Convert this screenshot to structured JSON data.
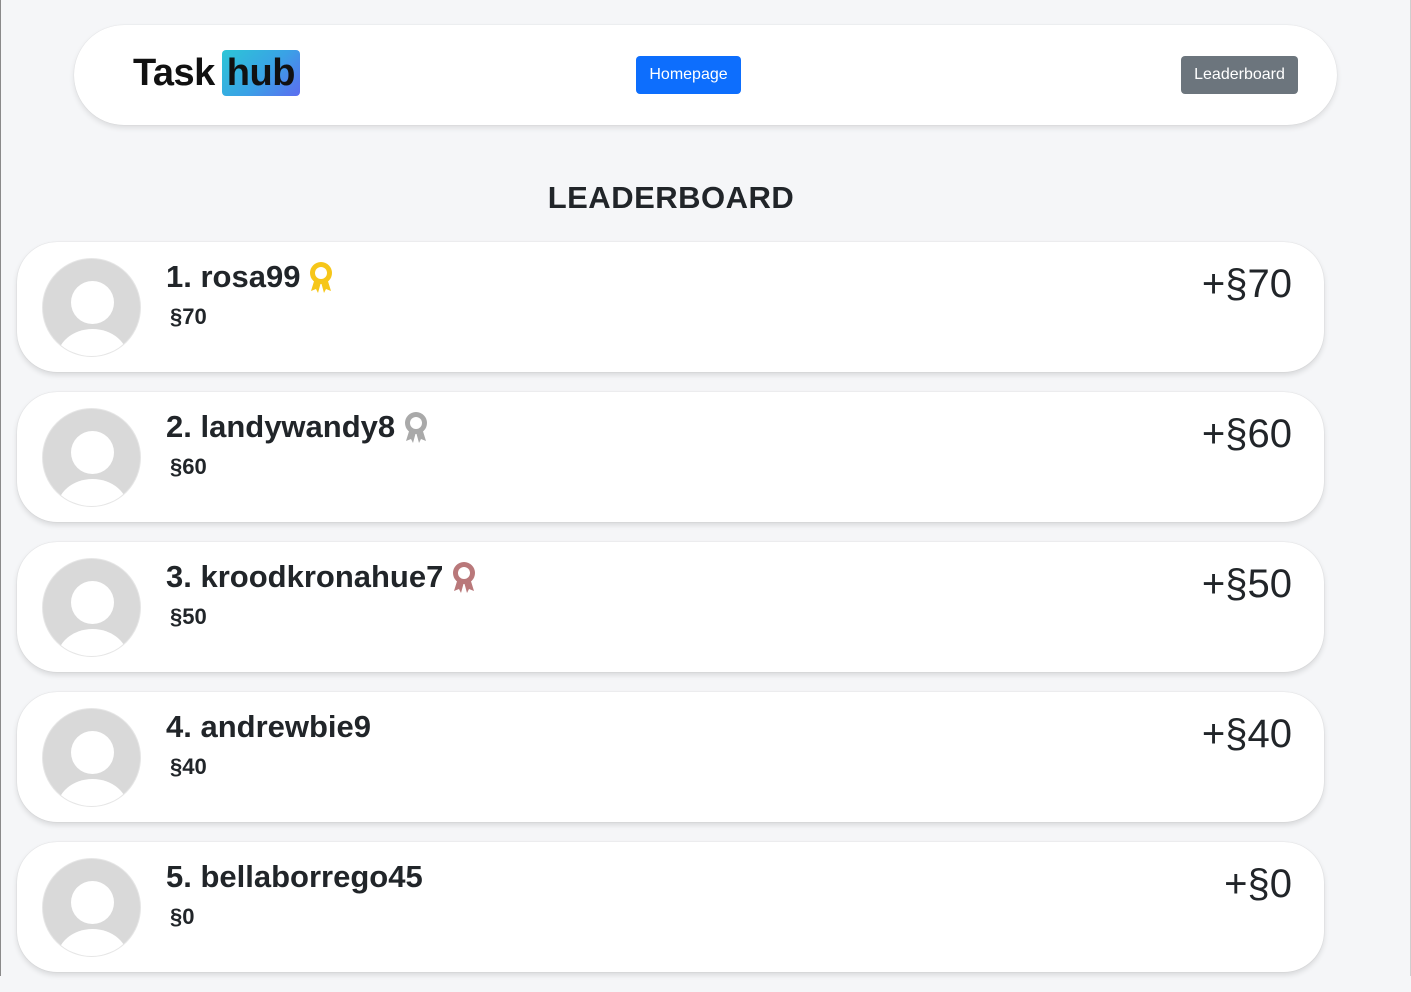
{
  "header": {
    "logo_task": "Task",
    "logo_hub": "hub",
    "homepage_label": "Homepage",
    "leaderboard_label": "Leaderboard"
  },
  "page_title": "LEADERBOARD",
  "colors": {
    "primary": "#0d6efd",
    "secondary": "#6c757d",
    "gold": "#f6c619",
    "silver": "#a9a9a9",
    "bronze": "#b9787a"
  },
  "entries": [
    {
      "rank_name": "1. rosa99",
      "points": "§70",
      "gain": "+§70",
      "medal": "gold-medal-icon",
      "medal_color": "#f6c619"
    },
    {
      "rank_name": "2. landywandy8",
      "points": "§60",
      "gain": "+§60",
      "medal": "silver-medal-icon",
      "medal_color": "#a9a9a9"
    },
    {
      "rank_name": "3. kroodkronahue7",
      "points": "§50",
      "gain": "+§50",
      "medal": "bronze-medal-icon",
      "medal_color": "#b9787a"
    },
    {
      "rank_name": "4. andrewbie9",
      "points": "§40",
      "gain": "+§40",
      "medal": "",
      "medal_color": ""
    },
    {
      "rank_name": "5. bellaborrego45",
      "points": "§0",
      "gain": "+§0",
      "medal": "",
      "medal_color": ""
    }
  ]
}
